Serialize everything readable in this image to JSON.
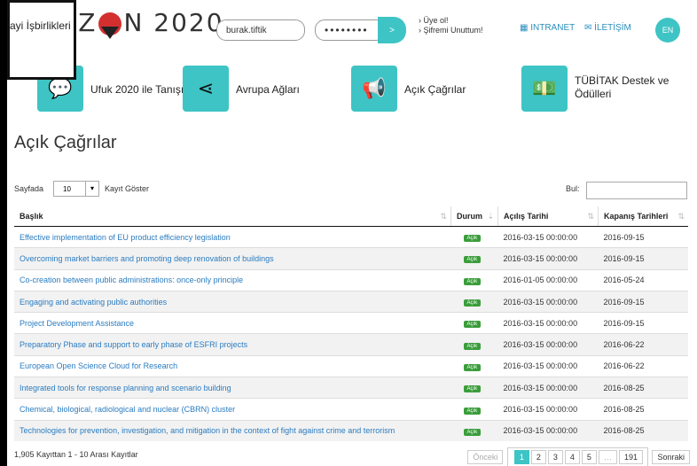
{
  "header": {
    "logo_text_left": "IZ",
    "logo_text_right": "N 2020",
    "username_value": "burak.tiftik",
    "password_value": "••••••••",
    "go_label": ">",
    "register_label": "› Üye ol!",
    "forgot_label": "› Şifremi Unuttum!",
    "intranet_label": "▦ INTRANET",
    "contact_label": "✉ İLETİŞİM",
    "lang_label": "EN"
  },
  "popup": {
    "text": "ayi İşbirlikleri"
  },
  "nav": [
    {
      "label": "Ufuk 2020 ile Tanışın!",
      "icon": "speech-bubble-icon",
      "glyph": "💬"
    },
    {
      "label": "Avrupa Ağları",
      "icon": "share-icon",
      "glyph": "⋖"
    },
    {
      "label": "Açık Çağrılar",
      "icon": "megaphone-icon",
      "glyph": "📢"
    },
    {
      "label": "TÜBİTAK Destek ve Ödülleri",
      "icon": "money-icon",
      "glyph": "💵"
    }
  ],
  "main": {
    "title": "Açık Çağrılar",
    "length_prefix": "Sayfada",
    "length_value": "10",
    "length_suffix": "Kayıt Göster",
    "search_label": "Bul:",
    "columns": [
      "Başlık",
      "Durum",
      "Açılış Tarihi",
      "Kapanış Tarihleri"
    ],
    "status_label": "Açık",
    "rows": [
      {
        "title": "Effective implementation of EU product efficiency legislation",
        "open": "2016-03-15 00:00:00",
        "close": "2016-09-15"
      },
      {
        "title": "Overcoming market barriers and promoting deep renovation of buildings",
        "open": "2016-03-15 00:00:00",
        "close": "2016-09-15"
      },
      {
        "title": "Co-creation between public administrations: once-only principle",
        "open": "2016-01-05 00:00:00",
        "close": "2016-05-24"
      },
      {
        "title": "Engaging and activating public authorities",
        "open": "2016-03-15 00:00:00",
        "close": "2016-09-15"
      },
      {
        "title": "Project Development Assistance",
        "open": "2016-03-15 00:00:00",
        "close": "2016-09-15"
      },
      {
        "title": "Preparatory Phase and support to early phase of ESFRI projects",
        "open": "2016-03-15 00:00:00",
        "close": "2016-06-22"
      },
      {
        "title": "European Open Science Cloud for Research",
        "open": "2016-03-15 00:00:00",
        "close": "2016-06-22"
      },
      {
        "title": "Integrated tools for response planning and scenario building",
        "open": "2016-03-15 00:00:00",
        "close": "2016-08-25"
      },
      {
        "title": "Chemical, biological, radiological and nuclear (CBRN) cluster",
        "open": "2016-03-15 00:00:00",
        "close": "2016-08-25"
      },
      {
        "title": "Technologies for prevention, investigation, and mitigation in the context of fight against crime and terrorism",
        "open": "2016-03-15 00:00:00",
        "close": "2016-08-25"
      }
    ],
    "info": "1,905 Kayıttan 1 - 10 Arası Kayıtlar",
    "pager": {
      "prev": "Önceki",
      "pages": [
        "1",
        "2",
        "3",
        "4",
        "5",
        "…",
        "191"
      ],
      "next": "Sonraki",
      "current": "1"
    }
  }
}
